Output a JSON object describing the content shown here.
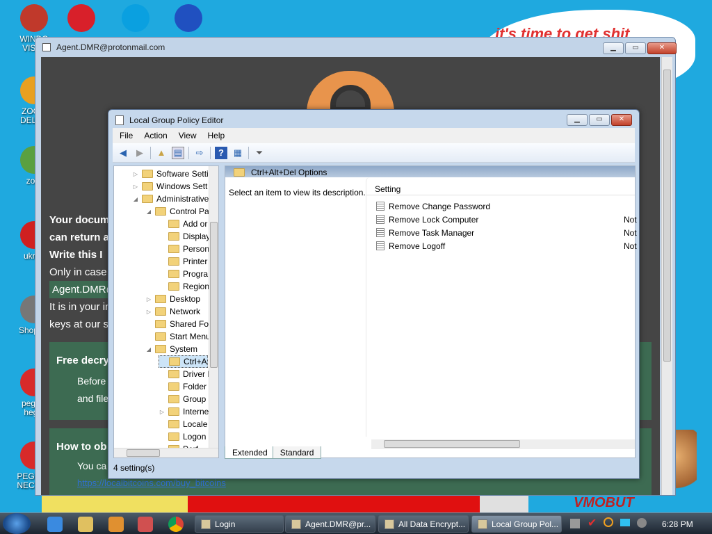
{
  "desktop": {
    "bubble_text": "it's time to get shit",
    "mascot_text": "VMOBUT",
    "icons": [
      {
        "label": "WINDO\nVISTA",
        "color": "#c0392b"
      },
      {
        "label": "",
        "color": "#d8202a"
      },
      {
        "label": "",
        "color": "#0aa0e0"
      },
      {
        "label": "",
        "color": "#2050c0"
      },
      {
        "label": "ZOOM\nDELUX",
        "color": "#e8a020"
      },
      {
        "label": "zom",
        "color": "#5aa040"
      },
      {
        "label": "ukrair",
        "color": "#d02020"
      },
      {
        "label": "Shoppin",
        "color": "#777777"
      },
      {
        "label": "peggle\nheggl",
        "color": "#d82a2a"
      },
      {
        "label": "PEGGLE\nNECKBE",
        "color": "#d82a2a"
      }
    ]
  },
  "ransom_window": {
    "title": "Agent.DMR@protonmail.com",
    "lines": [
      "Your docum",
      "can return a",
      "Write this I",
      "Only in case",
      "Agent.DMR@",
      "It is in your in",
      "keys at our s"
    ],
    "free_decrypt": "Free decry",
    "free_line1": "Before",
    "free_line2": "and file",
    "howto": "How to ob",
    "howto_line": "You ca",
    "link": "https://localbitcoins.com/buy_bitcoins"
  },
  "gpedit": {
    "title": "Local Group Policy Editor",
    "menu": [
      "File",
      "Action",
      "View",
      "Help"
    ],
    "tree": [
      {
        "label": "Software Setti",
        "indent": 0,
        "arrow": "▷"
      },
      {
        "label": "Windows Sett",
        "indent": 0,
        "arrow": "▷"
      },
      {
        "label": "Administrative",
        "indent": 0,
        "arrow": "◢"
      },
      {
        "label": "Control Pa",
        "indent": 1,
        "arrow": "◢"
      },
      {
        "label": "Add or",
        "indent": 2,
        "arrow": ""
      },
      {
        "label": "Display",
        "indent": 2,
        "arrow": ""
      },
      {
        "label": "Person",
        "indent": 2,
        "arrow": ""
      },
      {
        "label": "Printer",
        "indent": 2,
        "arrow": ""
      },
      {
        "label": "Progra",
        "indent": 2,
        "arrow": ""
      },
      {
        "label": "Region",
        "indent": 2,
        "arrow": ""
      },
      {
        "label": "Desktop",
        "indent": 1,
        "arrow": "▷"
      },
      {
        "label": "Network",
        "indent": 1,
        "arrow": "▷"
      },
      {
        "label": "Shared Fol",
        "indent": 1,
        "arrow": ""
      },
      {
        "label": "Start Menu",
        "indent": 1,
        "arrow": ""
      },
      {
        "label": "System",
        "indent": 1,
        "arrow": "◢"
      },
      {
        "label": "Ctrl+A",
        "indent": 2,
        "arrow": "",
        "selected": true
      },
      {
        "label": "Driver I",
        "indent": 2,
        "arrow": ""
      },
      {
        "label": "Folder",
        "indent": 2,
        "arrow": ""
      },
      {
        "label": "Group",
        "indent": 2,
        "arrow": ""
      },
      {
        "label": "Interne",
        "indent": 2,
        "arrow": "▷"
      },
      {
        "label": "Locale",
        "indent": 2,
        "arrow": ""
      },
      {
        "label": "Logon",
        "indent": 2,
        "arrow": ""
      },
      {
        "label": "Perf",
        "indent": 2,
        "arrow": ""
      }
    ],
    "header": "Ctrl+Alt+Del Options",
    "description": "Select an item to view its description.",
    "col_setting": "Setting",
    "settings": [
      {
        "name": "Remove Change Password",
        "state": ""
      },
      {
        "name": "Remove Lock Computer",
        "state": "Not"
      },
      {
        "name": "Remove Task Manager",
        "state": "Not"
      },
      {
        "name": "Remove Logoff",
        "state": "Not"
      }
    ],
    "tabs": [
      "Extended",
      "Standard"
    ],
    "status": "4 setting(s)"
  },
  "taskbar": {
    "tasks": [
      "Login",
      "Agent.DMR@pr...",
      "All Data Encrypt...",
      "Local Group Pol..."
    ],
    "clock": "6:28 PM"
  }
}
